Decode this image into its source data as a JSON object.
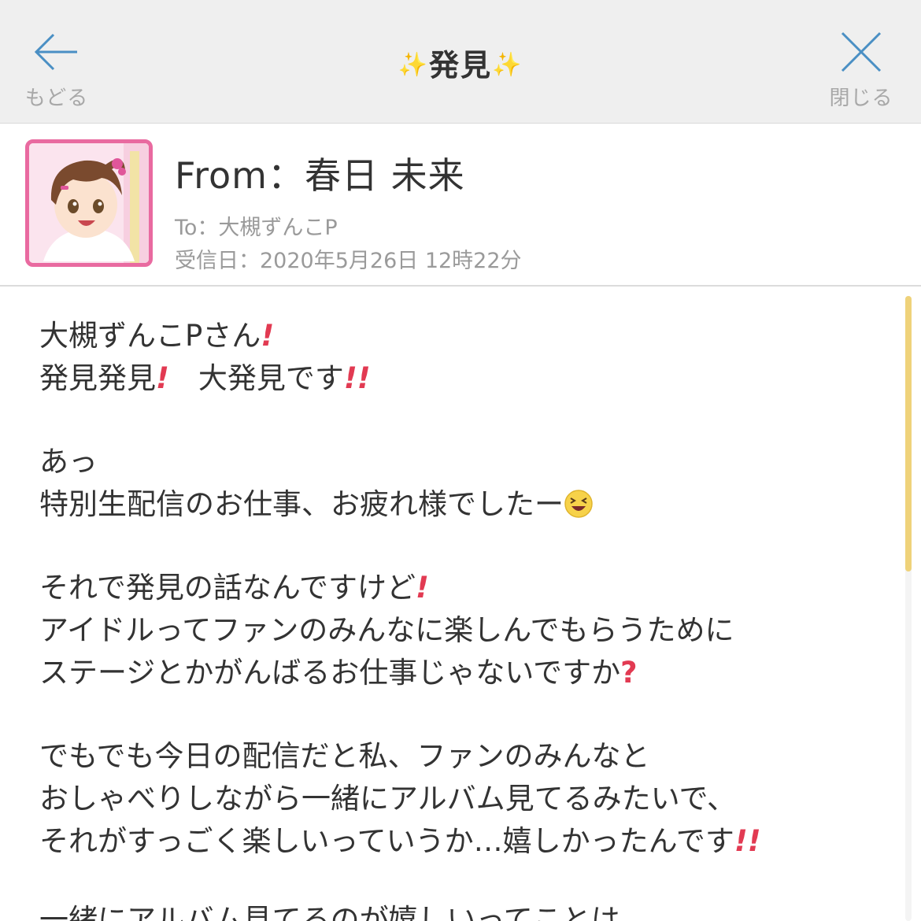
{
  "header": {
    "back_label": "もどる",
    "title": "発見",
    "close_label": "閉じる"
  },
  "sender": {
    "from": "From：春日 未来",
    "to": "To：大槻ずんこP",
    "received": "受信日：2020年5月26日 12時22分"
  },
  "message": {
    "line1": "大槻ずんこPさん",
    "line2a": "発見発見",
    "line2b": "　大発見です",
    "line3": "あっ",
    "line4": "特別生配信のお仕事、お疲れ様でしたー",
    "line5": "それで発見の話なんですけど",
    "line6": "アイドルってファンのみんなに楽しんでもらうために",
    "line7": "ステージとかがんばるお仕事じゃないですか",
    "line8": "でもでも今日の配信だと私、ファンのみんなと",
    "line9": "おしゃべりしながら一緒にアルバム見てるみたいで、",
    "line10": "それがすっごく楽しいっていうか…嬉しかったんです",
    "line11": "一緒にアルバム見てるのが嬉しいってことは"
  },
  "colors": {
    "accent_pink": "#e96aa0",
    "exclamation_red": "#e23a52",
    "scroll_thumb": "#efd27a"
  },
  "icons": {
    "back": "arrow-left-icon",
    "close": "close-icon",
    "title_decoration": "sparkles-icon",
    "emoji": "grinning-squint-face-icon"
  }
}
